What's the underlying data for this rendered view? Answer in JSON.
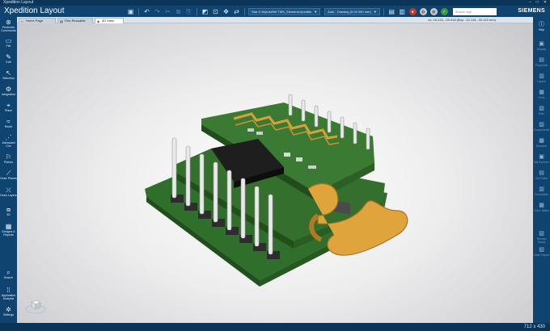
{
  "window": {
    "title": "Xpedition Layout",
    "controls": [
      "–",
      "□",
      "✕"
    ]
  },
  "app": {
    "title": "Xpedition Layout",
    "brand": "SIEMENS"
  },
  "toolbar": {
    "project_select": "Star C:\\MyUsrRef TMS_Siemens\\Xpeditio",
    "scheme_select": "Auto - Drawing (0.00 000 mm)",
    "search_placeholder": "Search app"
  },
  "left_sidebar": [
    {
      "label": "Predictive Commands",
      "icon": "predictive-commands-icon"
    },
    {
      "label": "File",
      "icon": "file-icon"
    },
    {
      "label": "Edit",
      "icon": "edit-icon"
    },
    {
      "label": "Selection",
      "icon": "selection-icon"
    },
    {
      "label": "Integration",
      "icon": "integration-icon"
    },
    {
      "label": "Place",
      "icon": "place-icon"
    },
    {
      "label": "Route",
      "icon": "route-icon"
    },
    {
      "label": "Advanced Circ",
      "icon": "advanced-circuit-icon"
    },
    {
      "label": "Planes",
      "icon": "planes-icon"
    },
    {
      "label": "Draw Planes",
      "icon": "draw-planes-icon"
    },
    {
      "label": "Draw Layers",
      "icon": "draw-layers-icon"
    },
    {
      "label": "3D",
      "icon": "3d-icon"
    },
    {
      "label": "Designs & Reports",
      "icon": "designs-reports-icon"
    },
    {
      "label": "Search",
      "icon": "search-icon"
    },
    {
      "label": "Application Analysis",
      "icon": "application-analysis-icon"
    },
    {
      "label": "Settings",
      "icon": "settings-icon"
    }
  ],
  "tabs": [
    {
      "label": "Home Page",
      "active": false
    },
    {
      "label": "Flex Reusable",
      "active": false
    },
    {
      "label": "3D View",
      "active": true
    }
  ],
  "coords": "xx: 16.416, -25.518 (Bcp: -12.115, -32.115 mm)",
  "right_sidebar": [
    {
      "label": "Help",
      "active": true
    },
    {
      "label": "Display",
      "active": false
    },
    {
      "label": "Properties",
      "active": false
    },
    {
      "label": "Layers",
      "active": false
    },
    {
      "label": "Parts",
      "active": false
    },
    {
      "label": "Nets",
      "active": false
    },
    {
      "label": "Components",
      "active": false
    },
    {
      "label": "Measure",
      "active": false
    },
    {
      "label": "Net Explorer",
      "active": false
    },
    {
      "label": "Cell Editor",
      "active": false
    },
    {
      "label": "Constraints",
      "active": false
    },
    {
      "label": "Color Tables",
      "active": false
    },
    {
      "label": "Review Status",
      "active": false
    },
    {
      "label": "Clash Report",
      "active": false
    }
  ],
  "status": {
    "size": "712 x 430"
  },
  "colors": {
    "chrome": "#0f4470",
    "pcb_green": "#2d6b2a",
    "copper": "#d49a2a",
    "flex": "#e0a43c"
  }
}
